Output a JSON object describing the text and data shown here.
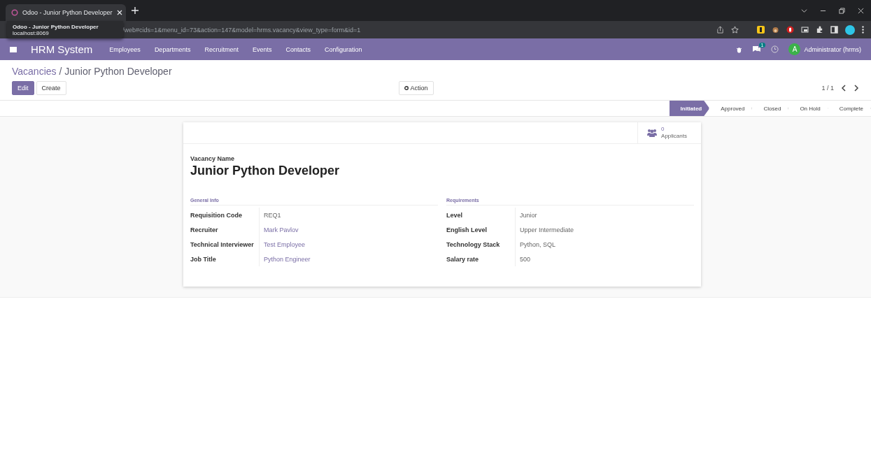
{
  "browser": {
    "tab_title": "Odoo - Junior Python Developer",
    "url": "/web#cids=1&menu_id=73&action=147&model=hrms.vacancy&view_type=form&id=1",
    "tooltip": {
      "title": "Odoo - Junior Python Developer",
      "subtitle": "localhost:8069"
    }
  },
  "navbar": {
    "brand": "HRM System",
    "menu": [
      "Employees",
      "Departments",
      "Recruitment",
      "Events",
      "Contacts",
      "Configuration"
    ],
    "messages_badge": "1",
    "user": {
      "initial": "A",
      "name": "Administrator (hrms)"
    }
  },
  "breadcrumb": {
    "parent": "Vacancies",
    "separator": "/",
    "current": "Junior Python Developer"
  },
  "buttons": {
    "edit": "Edit",
    "create": "Create",
    "action": "Action"
  },
  "pager": "1 / 1",
  "stages": [
    {
      "label": "Initiated",
      "selected": true
    },
    {
      "label": "Approved",
      "selected": false
    },
    {
      "label": "Closed",
      "selected": false
    },
    {
      "label": "On Hold",
      "selected": false
    },
    {
      "label": "Complete",
      "selected": false
    }
  ],
  "form": {
    "applicants_count": "0",
    "applicants_label": "Applicants",
    "name_label": "Vacancy Name",
    "name": "Junior Python Developer",
    "groups": [
      {
        "title": "General Info",
        "fields": [
          {
            "label": "Requisition Code",
            "value": "REQ1",
            "kind": "text"
          },
          {
            "label": "Recruiter",
            "value": "Mark Pavlov",
            "kind": "link"
          },
          {
            "label": "Technical Interviewer",
            "value": "Test Employee",
            "kind": "link"
          },
          {
            "label": "Job Title",
            "value": "Python Engineer",
            "kind": "link"
          }
        ]
      },
      {
        "title": "Requirements",
        "fields": [
          {
            "label": "Level",
            "value": "Junior",
            "kind": "text"
          },
          {
            "label": "English Level",
            "value": "Upper Intermediate",
            "kind": "text"
          },
          {
            "label": "Technology Stack",
            "value": "Python, SQL",
            "kind": "text"
          },
          {
            "label": "Salary rate",
            "value": "500",
            "kind": "text"
          }
        ]
      }
    ]
  }
}
